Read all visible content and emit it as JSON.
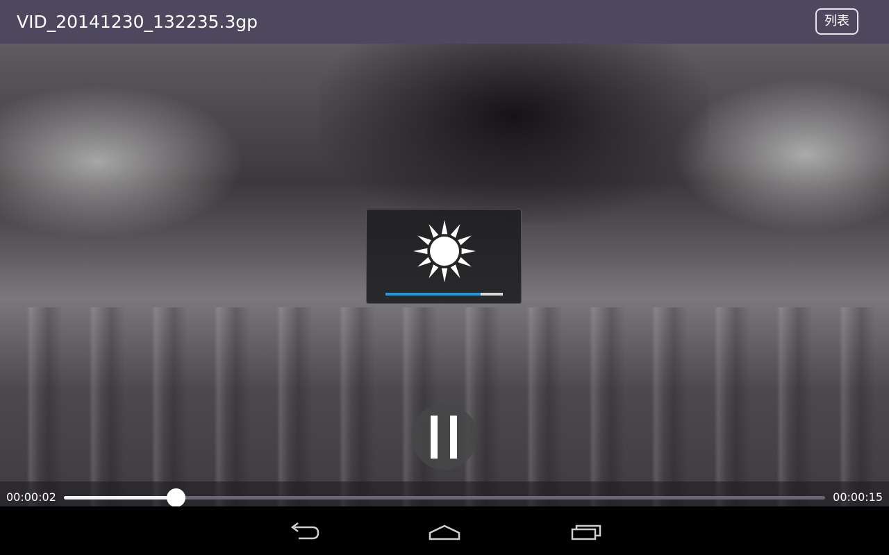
{
  "title_bar": {
    "title": "VID_20141230_132235.3gp",
    "list_button_label": "列表"
  },
  "brightness_overlay": {
    "icon": "sun-icon",
    "level": 0.81,
    "fill_color": "#1e9be0"
  },
  "playback": {
    "state_icon": "pause-icon",
    "current_time": "00:00:02",
    "total_time": "00:00:15",
    "progress": 0.147
  },
  "nav_bar": {
    "buttons": [
      "back-icon",
      "home-icon",
      "recent-apps-icon"
    ]
  }
}
